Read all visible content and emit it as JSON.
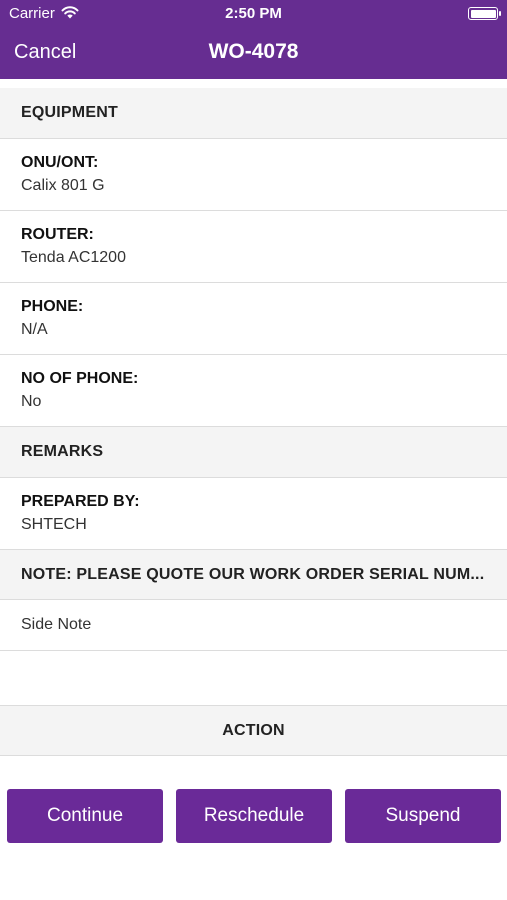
{
  "status_bar": {
    "carrier": "Carrier",
    "time": "2:50 PM"
  },
  "nav": {
    "cancel_label": "Cancel",
    "title": "WO-4078"
  },
  "sections": {
    "equipment": "EQUIPMENT",
    "remarks": "REMARKS",
    "note": "NOTE: PLEASE QUOTE OUR WORK ORDER SERIAL NUM...",
    "action": "ACTION"
  },
  "fields": [
    {
      "label": "ONU/ONT:",
      "value": "Calix 801 G"
    },
    {
      "label": "ROUTER:",
      "value": "Tenda AC1200"
    },
    {
      "label": "PHONE:",
      "value": "N/A"
    },
    {
      "label": "NO OF PHONE:",
      "value": "No"
    },
    {
      "label": "PREPARED BY:",
      "value": "SHTECH"
    }
  ],
  "side_note": "Side Note",
  "buttons": {
    "continue": "Continue",
    "reschedule": "Reschedule",
    "suspend": "Suspend"
  },
  "colors": {
    "brand": "#662d91",
    "button": "#6a2a98"
  },
  "icons": {
    "wifi": "wifi-icon",
    "battery": "battery-icon"
  }
}
